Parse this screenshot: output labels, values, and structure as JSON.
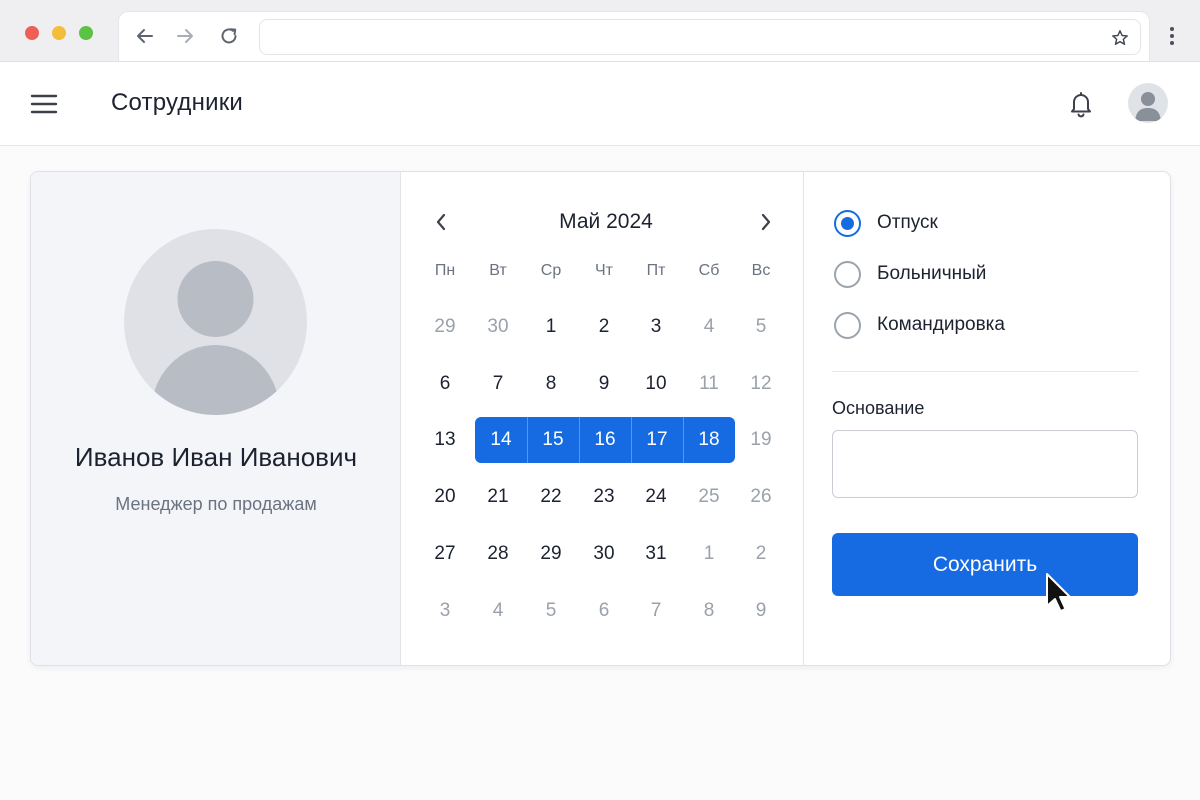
{
  "browser": {
    "address_value": "",
    "icons": [
      "arrow-left-icon",
      "arrow-right-icon",
      "reload-icon",
      "star-icon",
      "more-vertical-icon"
    ]
  },
  "header": {
    "title": "Сотрудники",
    "icons": [
      "hamburger-menu-icon",
      "bell-icon",
      "user-avatar-icon"
    ]
  },
  "profile": {
    "name": "Иванов Иван Иванович",
    "role": "Менеджер по продажам"
  },
  "calendar": {
    "title": "Май 2024",
    "weekdays": [
      "Пн",
      "Вт",
      "Ср",
      "Чт",
      "Пт",
      "Сб",
      "Вс"
    ],
    "weeks": [
      [
        "29",
        "30",
        "1",
        "2",
        "3",
        "4",
        "5"
      ],
      [
        "6",
        "7",
        "8",
        "9",
        "10",
        "11",
        "12"
      ],
      [
        "13",
        "14",
        "15",
        "16",
        "17",
        "18",
        "19"
      ],
      [
        "20",
        "21",
        "22",
        "23",
        "24",
        "25",
        "26"
      ],
      [
        "27",
        "28",
        "29",
        "30",
        "31",
        "1",
        "2"
      ],
      [
        "3",
        "4",
        "5",
        "6",
        "7",
        "8",
        "9"
      ]
    ],
    "selected_range": [
      "14",
      "18"
    ]
  },
  "form": {
    "options": [
      {
        "label": "Отпуск",
        "checked": true
      },
      {
        "label": "Больничный",
        "checked": false
      },
      {
        "label": "Командировка",
        "checked": false
      }
    ],
    "reason_label": "Основание",
    "reason_value": "",
    "save_label": "Сохранить"
  },
  "colors": {
    "accent": "#176be2",
    "muted_text": "#9aa1ab",
    "panel_bg": "#f4f5f8"
  }
}
